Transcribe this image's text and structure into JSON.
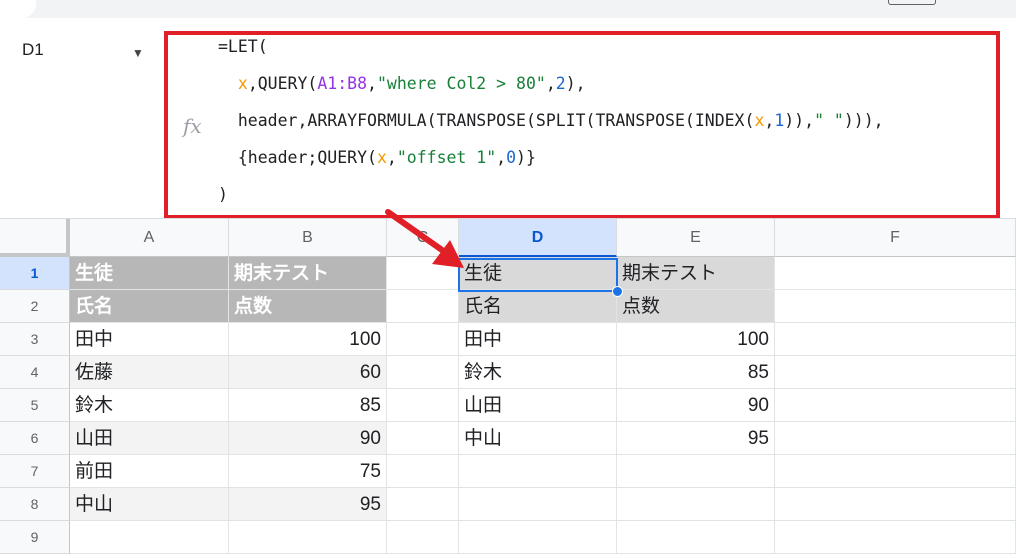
{
  "namebox": {
    "ref": "D1",
    "dropdown": "▼"
  },
  "fx_label": "fx",
  "formula": {
    "l1": "=LET(",
    "l2": {
      "a": "  ",
      "x": "x",
      "b": ",QUERY(",
      "rng": "A1:B8",
      "c": ",",
      "str": "\"where Col2 > 80\"",
      "d": ",",
      "num": "2",
      "e": "),"
    },
    "l3": {
      "a": "  header,ARRAYFORMULA(TRANSPOSE(SPLIT(TRANSPOSE(INDEX(",
      "x": "x",
      "b": ",",
      "num": "1",
      "c": ")),",
      "str": "\" \"",
      "d": "))),"
    },
    "l4": {
      "a": "  {header;QUERY(",
      "x": "x",
      "b": ",",
      "str": "\"offset 1\"",
      "c": ",",
      "num": "0",
      "d": ")}"
    },
    "l5": ")"
  },
  "columns": [
    "A",
    "B",
    "C",
    "D",
    "E",
    "F"
  ],
  "rows": [
    "1",
    "2",
    "3",
    "4",
    "5",
    "6",
    "7",
    "8",
    "9"
  ],
  "source_table": [
    [
      "生徒",
      "期末テスト"
    ],
    [
      "氏名",
      "点数"
    ],
    [
      "田中",
      "100"
    ],
    [
      "佐藤",
      "60"
    ],
    [
      "鈴木",
      "85"
    ],
    [
      "山田",
      "90"
    ],
    [
      "前田",
      "75"
    ],
    [
      "中山",
      "95"
    ]
  ],
  "result_table": [
    [
      "生徒",
      "期末テスト"
    ],
    [
      "氏名",
      "点数"
    ],
    [
      "田中",
      "100"
    ],
    [
      "鈴木",
      "85"
    ],
    [
      "山田",
      "90"
    ],
    [
      "中山",
      "95"
    ]
  ],
  "colors": {
    "highlight_box": "#e01f26",
    "selection": "#1a73e8",
    "header_fill": "#b7b7b7"
  }
}
